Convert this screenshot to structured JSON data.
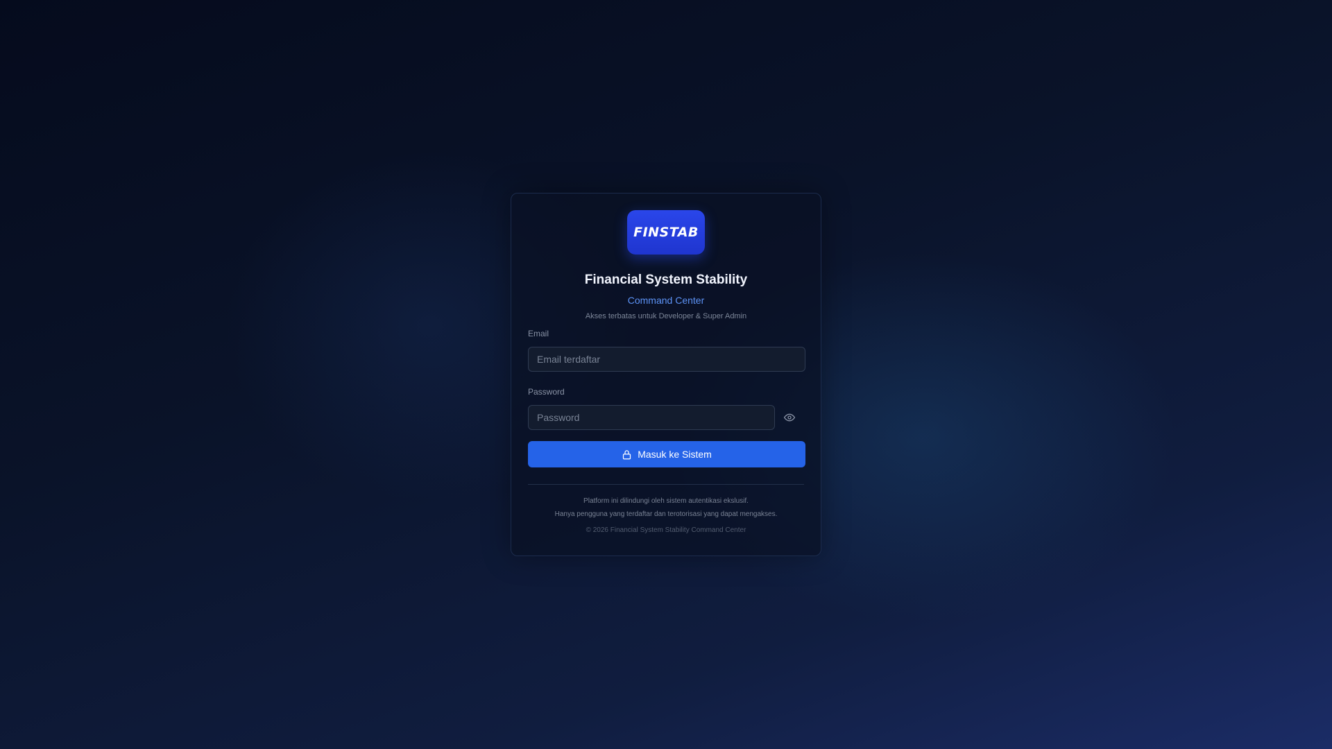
{
  "logo": {
    "text": "FINSTAB"
  },
  "header": {
    "title": "Financial System Stability",
    "subtitle": "Command Center",
    "note": "Akses terbatas untuk Developer & Super Admin"
  },
  "form": {
    "email_label": "Email",
    "email_placeholder": "Email terdaftar",
    "email_value": "",
    "password_label": "Password",
    "password_placeholder": "Password",
    "password_value": "",
    "toggle_icon": "eye-icon",
    "submit_icon": "lock-icon",
    "submit_label": "Masuk ke Sistem"
  },
  "footer": {
    "line1": "Platform ini dilindungi oleh sistem autentikasi ekslusif.",
    "line2": "Hanya pengguna yang terdaftar dan terotorisasi yang dapat mengakses.",
    "copyright": "© 2026 Financial System Stability Command Center"
  },
  "colors": {
    "accent": "#2563e8",
    "logo_bg": "#2a46ea",
    "subtitle": "#5d93f6"
  }
}
